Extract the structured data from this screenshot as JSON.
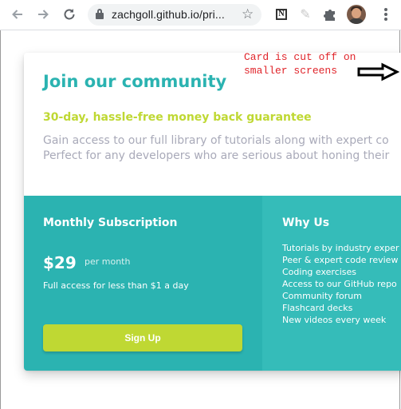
{
  "browser": {
    "url": "zachgoll.github.io/pri...",
    "back_icon": "arrow-left-icon",
    "forward_icon": "arrow-right-icon",
    "reload_icon": "reload-icon",
    "extensions": [
      "notion-icon",
      "pencil-icon",
      "puzzle-icon",
      "avatar",
      "kebab-menu-icon"
    ]
  },
  "card": {
    "title": "Join our community",
    "guarantee": "30-day, hassle-free money back guarantee",
    "description_lines": [
      "Gain access to our full library of tutorials along with expert co",
      "Perfect for any developers who are serious about honing their"
    ],
    "subscription": {
      "heading": "Monthly Subscription",
      "price": "$29",
      "period": "per month",
      "access_note": "Full access for less than $1 a day",
      "button_label": "Sign Up"
    },
    "why_us": {
      "heading": "Why Us",
      "items": [
        "Tutorials by industry exper",
        "Peer & expert code review",
        "Coding exercises",
        "Access to our GitHub repo",
        "Community forum",
        "Flashcard decks",
        "New videos every week"
      ]
    }
  },
  "annotation": {
    "lines": [
      "Card is cut off on",
      "smaller screens"
    ],
    "color": "#e0242a"
  },
  "colors": {
    "teal": "#2bb3b1",
    "teal_light": "#35bcb9",
    "lime": "#bfd833",
    "gray_text": "#a9aab9"
  }
}
